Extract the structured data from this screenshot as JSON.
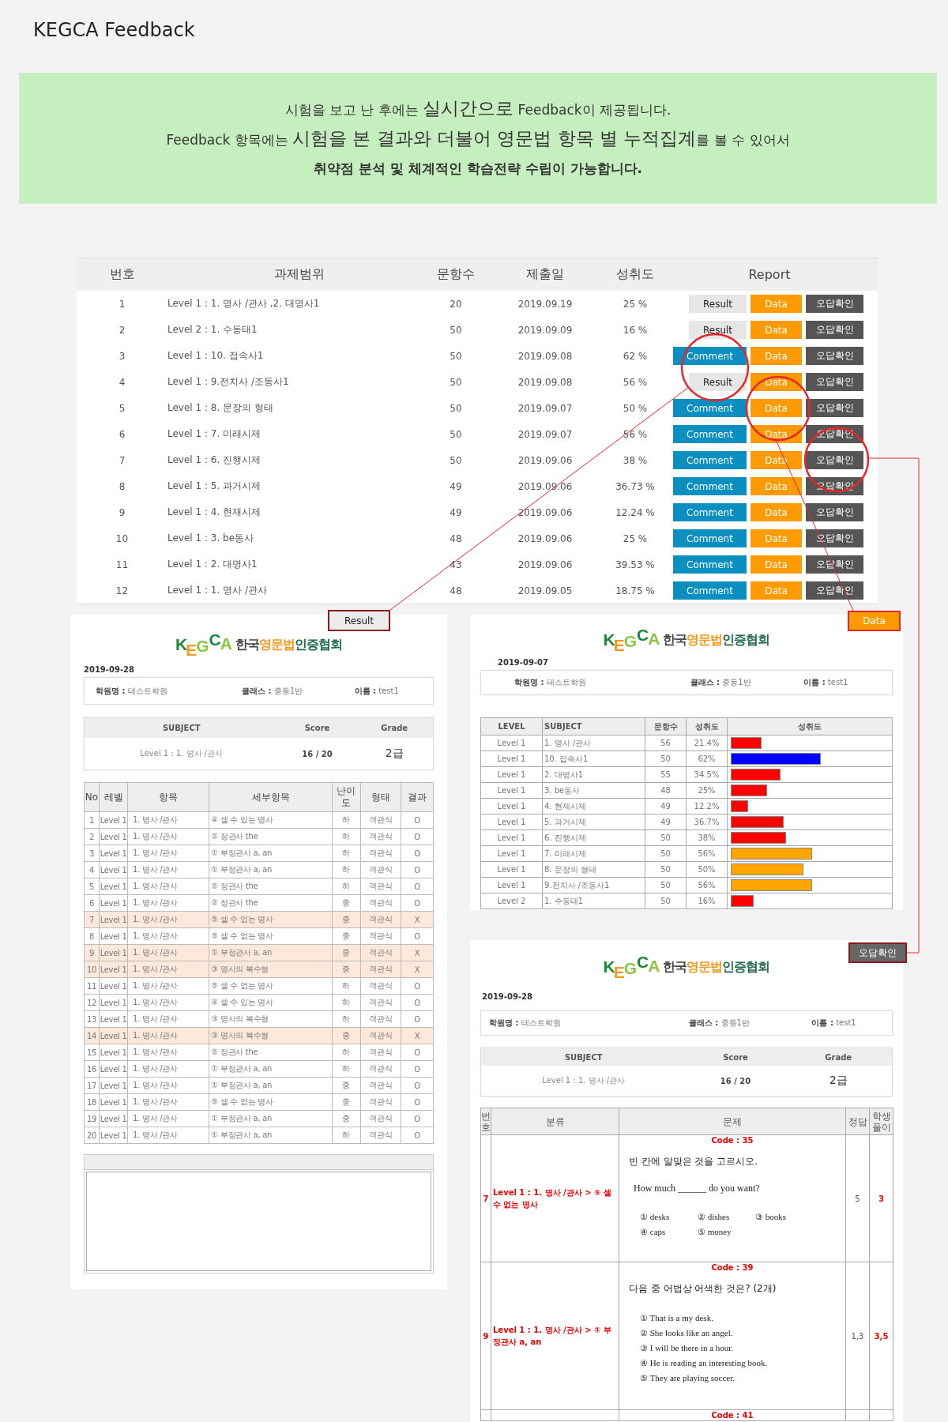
{
  "page_title": "KEGCA Feedback",
  "banner": {
    "lines": [
      {
        "text": "시험을 보고 난 후에는 **실시간으로** Feedback이 제공됩니다.",
        "bold": false
      },
      {
        "text": "Feedback 항목에는 **시험을 본 결과와 더불어 영문법 항목 별 누적집계**를 볼 수 있어서",
        "bold": false
      },
      {
        "text": "취약점 분석 및 체계적인 학습전략 수립이 가능합니다.",
        "bold": true
      }
    ]
  },
  "submissions": {
    "columns": [
      "번호",
      "과제범위",
      "문항수",
      "제출일",
      "성취도",
      "Report"
    ],
    "rows": [
      {
        "no": "1",
        "scope": "Level 1 : 1. 명사 /관사 ,2. 대명사1",
        "count": "20",
        "date": "2019.09.19",
        "achievement": "25 %",
        "buttons": [
          {
            "kind": "result",
            "label": "Result"
          },
          {
            "kind": "data",
            "label": "Data"
          },
          {
            "kind": "wrong",
            "label": "오답확인"
          }
        ]
      },
      {
        "no": "2",
        "scope": "Level 2 : 1. 수동태1",
        "count": "50",
        "date": "2019.09.09",
        "achievement": "16 %",
        "buttons": [
          {
            "kind": "result",
            "label": "Result"
          },
          {
            "kind": "data",
            "label": "Data"
          },
          {
            "kind": "wrong",
            "label": "오답확인"
          }
        ]
      },
      {
        "no": "3",
        "scope": "Level 1 : 10. 접속사1",
        "count": "50",
        "date": "2019.09.08",
        "achievement": "62 %",
        "buttons": [
          {
            "kind": "comment",
            "label": "Comment"
          },
          {
            "kind": "data",
            "label": "Data"
          },
          {
            "kind": "wrong",
            "label": "오답확인"
          }
        ]
      },
      {
        "no": "4",
        "scope": "Level 1 : 9.전치사 /조동사1",
        "count": "50",
        "date": "2019.09.08",
        "achievement": "56 %",
        "buttons": [
          {
            "kind": "result",
            "label": "Result"
          },
          {
            "kind": "data",
            "label": "Data"
          },
          {
            "kind": "wrong",
            "label": "오답확인"
          }
        ]
      },
      {
        "no": "5",
        "scope": "Level 1 : 8. 문장의 형태",
        "count": "50",
        "date": "2019.09.07",
        "achievement": "50 %",
        "buttons": [
          {
            "kind": "comment",
            "label": "Comment"
          },
          {
            "kind": "data",
            "label": "Data"
          },
          {
            "kind": "wrong",
            "label": "오답확인"
          }
        ]
      },
      {
        "no": "6",
        "scope": "Level 1 : 7. 미래시제",
        "count": "50",
        "date": "2019.09.07",
        "achievement": "56 %",
        "buttons": [
          {
            "kind": "comment",
            "label": "Comment"
          },
          {
            "kind": "data",
            "label": "Data"
          },
          {
            "kind": "wrong",
            "label": "오답확인"
          }
        ]
      },
      {
        "no": "7",
        "scope": "Level 1 : 6. 진행시제",
        "count": "50",
        "date": "2019.09.06",
        "achievement": "38 %",
        "buttons": [
          {
            "kind": "comment",
            "label": "Comment"
          },
          {
            "kind": "data",
            "label": "Data"
          },
          {
            "kind": "wrong",
            "label": "오답확인"
          }
        ]
      },
      {
        "no": "8",
        "scope": "Level 1 : 5. 과거시제",
        "count": "49",
        "date": "2019.09.06",
        "achievement": "36.73 %",
        "buttons": [
          {
            "kind": "comment",
            "label": "Comment"
          },
          {
            "kind": "data",
            "label": "Data"
          },
          {
            "kind": "wrong",
            "label": "오답확인"
          }
        ]
      },
      {
        "no": "9",
        "scope": "Level 1 : 4. 현재시제",
        "count": "49",
        "date": "2019.09.06",
        "achievement": "12.24 %",
        "buttons": [
          {
            "kind": "comment",
            "label": "Comment"
          },
          {
            "kind": "data",
            "label": "Data"
          },
          {
            "kind": "wrong",
            "label": "오답확인"
          }
        ]
      },
      {
        "no": "10",
        "scope": "Level 1 : 3. be동사",
        "count": "48",
        "date": "2019.09.06",
        "achievement": "25 %",
        "buttons": [
          {
            "kind": "comment",
            "label": "Comment"
          },
          {
            "kind": "data",
            "label": "Data"
          },
          {
            "kind": "wrong",
            "label": "오답확인"
          }
        ]
      },
      {
        "no": "11",
        "scope": "Level 1 : 2. 대명사1",
        "count": "43",
        "date": "2019.09.06",
        "achievement": "39.53 %",
        "buttons": [
          {
            "kind": "comment",
            "label": "Comment"
          },
          {
            "kind": "data",
            "label": "Data"
          },
          {
            "kind": "wrong",
            "label": "오답확인"
          }
        ]
      },
      {
        "no": "12",
        "scope": "Level 1 : 1. 명사 /관사",
        "count": "48",
        "date": "2019.09.05",
        "achievement": "18.75 %",
        "buttons": [
          {
            "kind": "comment",
            "label": "Comment"
          },
          {
            "kind": "data",
            "label": "Data"
          },
          {
            "kind": "wrong",
            "label": "오답확인"
          }
        ]
      }
    ]
  },
  "callouts": [
    {
      "kind": "result",
      "label": "Result"
    },
    {
      "kind": "data",
      "label": "Data"
    },
    {
      "kind": "wrong",
      "label": "오답확인"
    }
  ],
  "result_report": {
    "logo": {
      "letters": "KEGCA",
      "name_parts": [
        "한국",
        "영문법",
        "인증협회"
      ]
    },
    "date": "2019-09-28",
    "info": [
      "**학원명 :** 테스트학원",
      "**클래스 :** 중등1반",
      "**이름 :** test1"
    ],
    "summary": {
      "columns": [
        "SUBJECT",
        "Score",
        "Grade"
      ],
      "subject": "Level 1 : 1. 명사 /관사",
      "score": "16 / 20",
      "grade": "2급"
    },
    "columns": [
      "No",
      "레벨",
      "항목",
      "세부항목",
      "난이도",
      "형태",
      "결과"
    ],
    "rows": [
      {
        "no": "1",
        "level": "Level 1",
        "topic": "1. 명사 /관사",
        "detail": "④ 셀 수 있는 명사",
        "difficulty": "하",
        "type": "객관식",
        "result": "O",
        "wrong": false
      },
      {
        "no": "2",
        "level": "Level 1",
        "topic": "1. 명사 /관사",
        "detail": "② 정관사 the",
        "difficulty": "하",
        "type": "객관식",
        "result": "O",
        "wrong": false
      },
      {
        "no": "3",
        "level": "Level 1",
        "topic": "1. 명사 /관사",
        "detail": "① 부정관사 a, an",
        "difficulty": "하",
        "type": "객관식",
        "result": "O",
        "wrong": false
      },
      {
        "no": "4",
        "level": "Level 1",
        "topic": "1. 명사 /관사",
        "detail": "① 부정관사 a, an",
        "difficulty": "하",
        "type": "객관식",
        "result": "O",
        "wrong": false
      },
      {
        "no": "5",
        "level": "Level 1",
        "topic": "1. 명사 /관사",
        "detail": "② 정관사 the",
        "difficulty": "하",
        "type": "객관식",
        "result": "O",
        "wrong": false
      },
      {
        "no": "6",
        "level": "Level 1",
        "topic": "1. 명사 /관사",
        "detail": "② 정관사 the",
        "difficulty": "중",
        "type": "객관식",
        "result": "O",
        "wrong": false
      },
      {
        "no": "7",
        "level": "Level 1",
        "topic": "1. 명사 /관사",
        "detail": "⑤ 셀 수 없는 명사",
        "difficulty": "중",
        "type": "객관식",
        "result": "X",
        "wrong": true
      },
      {
        "no": "8",
        "level": "Level 1",
        "topic": "1. 명사 /관사",
        "detail": "⑤ 셀 수 없는 명사",
        "difficulty": "중",
        "type": "객관식",
        "result": "O",
        "wrong": false
      },
      {
        "no": "9",
        "level": "Level 1",
        "topic": "1. 명사 /관사",
        "detail": "① 부정관사 a, an",
        "difficulty": "중",
        "type": "객관식",
        "result": "X",
        "wrong": true
      },
      {
        "no": "10",
        "level": "Level 1",
        "topic": "1. 명사 /관사",
        "detail": "③ 명사의 복수형",
        "difficulty": "중",
        "type": "객관식",
        "result": "X",
        "wrong": true
      },
      {
        "no": "11",
        "level": "Level 1",
        "topic": "1. 명사 /관사",
        "detail": "⑤ 셀 수 없는 명사",
        "difficulty": "하",
        "type": "객관식",
        "result": "O",
        "wrong": false
      },
      {
        "no": "12",
        "level": "Level 1",
        "topic": "1. 명사 /관사",
        "detail": "④ 셀 수 있는 명사",
        "difficulty": "하",
        "type": "객관식",
        "result": "O",
        "wrong": false
      },
      {
        "no": "13",
        "level": "Level 1",
        "topic": "1. 명사 /관사",
        "detail": "③ 명사의 복수형",
        "difficulty": "하",
        "type": "객관식",
        "result": "O",
        "wrong": false
      },
      {
        "no": "14",
        "level": "Level 1",
        "topic": "1. 명사 /관사",
        "detail": "③ 명사의 복수형",
        "difficulty": "중",
        "type": "객관식",
        "result": "X",
        "wrong": true
      },
      {
        "no": "15",
        "level": "Level 1",
        "topic": "1. 명사 /관사",
        "detail": "② 정관사 the",
        "difficulty": "하",
        "type": "객관식",
        "result": "O",
        "wrong": false
      },
      {
        "no": "16",
        "level": "Level 1",
        "topic": "1. 명사 /관사",
        "detail": "① 부정관사 a, an",
        "difficulty": "하",
        "type": "객관식",
        "result": "O",
        "wrong": false
      },
      {
        "no": "17",
        "level": "Level 1",
        "topic": "1. 명사 /관사",
        "detail": "① 부정관사 a, an",
        "difficulty": "중",
        "type": "객관식",
        "result": "O",
        "wrong": false
      },
      {
        "no": "18",
        "level": "Level 1",
        "topic": "1. 명사 /관사",
        "detail": "⑤ 셀 수 없는 명사",
        "difficulty": "중",
        "type": "객관식",
        "result": "O",
        "wrong": false
      },
      {
        "no": "19",
        "level": "Level 1",
        "topic": "1. 명사 /관사",
        "detail": "① 부정관사 a, an",
        "difficulty": "중",
        "type": "객관식",
        "result": "O",
        "wrong": false
      },
      {
        "no": "20",
        "level": "Level 1",
        "topic": "1. 명사 /관사",
        "detail": "① 부정관사 a, an",
        "difficulty": "하",
        "type": "객관식",
        "result": "O",
        "wrong": false
      }
    ]
  },
  "data_report": {
    "logo": {
      "letters": "KEGCA",
      "name_parts": [
        "한국",
        "영문법",
        "인증협회"
      ]
    },
    "date": "2019-09-07",
    "info": [
      "**학원명 :** 테스트학원",
      "**클래스 :** 중등1반",
      "**이름 :** test1"
    ],
    "columns": [
      "LEVEL",
      "SUBJECT",
      "문항수",
      "성취도",
      "성취도"
    ],
    "rows": [
      {
        "level_name": "Level 1",
        "subject": "1. 명사 /관사",
        "count": "56",
        "percent": "21.4%",
        "level": 0.214,
        "color": "#ff0000"
      },
      {
        "level_name": "Level 1",
        "subject": "10. 접속사1",
        "count": "50",
        "percent": "62%",
        "level": 0.62,
        "color": "#0000ff"
      },
      {
        "level_name": "Level 1",
        "subject": "2. 대명사1",
        "count": "55",
        "percent": "34.5%",
        "level": 0.345,
        "color": "#ff0000"
      },
      {
        "level_name": "Level 1",
        "subject": "3. be동사",
        "count": "48",
        "percent": "25%",
        "level": 0.25,
        "color": "#ff0000"
      },
      {
        "level_name": "Level 1",
        "subject": "4. 현재시제",
        "count": "49",
        "percent": "12.2%",
        "level": 0.122,
        "color": "#ff0000"
      },
      {
        "level_name": "Level 1",
        "subject": "5. 과거시제",
        "count": "49",
        "percent": "36.7%",
        "level": 0.367,
        "color": "#ff0000"
      },
      {
        "level_name": "Level 1",
        "subject": "6. 진행시제",
        "count": "50",
        "percent": "38%",
        "level": 0.38,
        "color": "#ff0000"
      },
      {
        "level_name": "Level 1",
        "subject": "7. 미래시제",
        "count": "50",
        "percent": "56%",
        "level": 0.56,
        "color": "#ffa500"
      },
      {
        "level_name": "Level 1",
        "subject": "8. 문장의 형태",
        "count": "50",
        "percent": "50%",
        "level": 0.5,
        "color": "#ffa500"
      },
      {
        "level_name": "Level 1",
        "subject": "9.전치사 /조동사1",
        "count": "50",
        "percent": "56%",
        "level": 0.56,
        "color": "#ffa500"
      },
      {
        "level_name": "Level 2",
        "subject": "1. 수동태1",
        "count": "50",
        "percent": "16%",
        "level": 0.16,
        "color": "#ff0000"
      }
    ]
  },
  "wrong_report": {
    "logo": {
      "letters": "KEGCA",
      "name_parts": [
        "한국",
        "영문법",
        "인증협회"
      ]
    },
    "date": "2019-09-28",
    "info": [
      "**학원명 :** 테스트학원",
      "**클래스 :** 중등1반",
      "**이름 :** test1"
    ],
    "summary": {
      "columns": [
        "SUBJECT",
        "Score",
        "Grade"
      ],
      "subject": "Level 1 : 1. 명사 /관사",
      "score": "16 / 20",
      "grade": "2급"
    },
    "columns": [
      "번호",
      "분류",
      "문제",
      "정답",
      "학생풀이"
    ],
    "rows": [
      {
        "no": "7",
        "category": "Level 1 : 1. 명사 /관사 > ⑤ 셀 수 없는 명사",
        "code": "Code : 35",
        "prompt": "빈 칸에 알맞은 것을 고르시오.",
        "sentence": "How much ______ do you want?",
        "kind": "grid",
        "options": [
          "① desks",
          "② dishes",
          "③ books",
          "④ caps",
          "⑤ money"
        ],
        "answer": "5",
        "student": "3"
      },
      {
        "no": "9",
        "category": "Level 1 : 1. 명사 /관사 > ① 부정관사 a, an",
        "code": "Code : 39",
        "prompt": "다음 중 어법상 어색한 것은? (2개)",
        "kind": "list",
        "options": [
          "① That is a my desk.",
          "② She looks like an angel.",
          "③ I will be there in a hour.",
          "④ He is reading an interesting book.",
          "⑤ They are playing soccer."
        ],
        "answer": "1,3",
        "student": "3,5"
      },
      {
        "code": "Code : 41"
      }
    ]
  }
}
